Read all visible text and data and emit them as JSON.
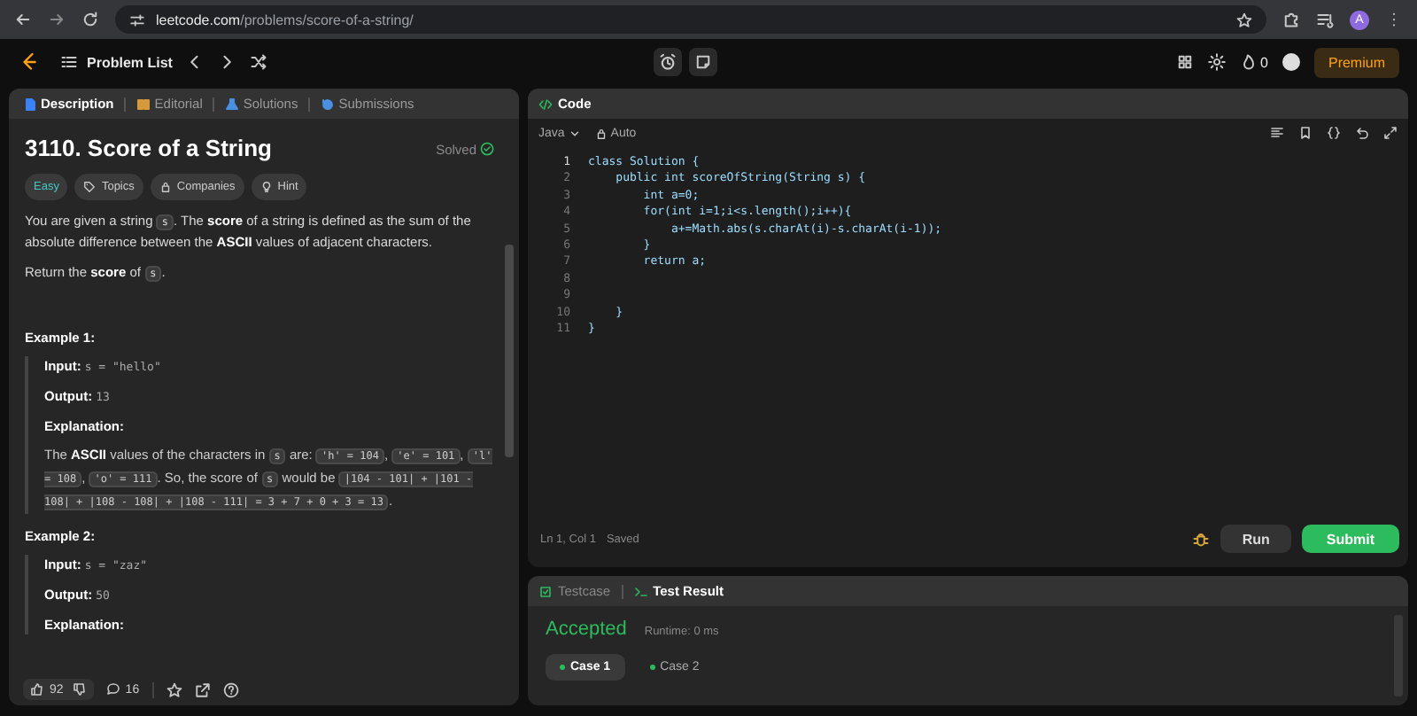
{
  "browser": {
    "url_host": "leetcode.com",
    "url_path": "/problems/score-of-a-string/",
    "profile_initial": "A"
  },
  "nav": {
    "title": "Problem List",
    "streak": "0",
    "premium": "Premium"
  },
  "description_panel": {
    "tabs": [
      {
        "label": "Description",
        "selected": true,
        "color": "#3b82f6"
      },
      {
        "label": "Editorial",
        "selected": false,
        "color": "#d69a3c"
      },
      {
        "label": "Solutions",
        "selected": false,
        "color": "#4a8fe0"
      },
      {
        "label": "Submissions",
        "selected": false,
        "color": "#4a8fe0"
      }
    ],
    "title": "3110. Score of a String",
    "status": "Solved",
    "tags": [
      {
        "kind": "difficulty",
        "label": "Easy"
      },
      {
        "kind": "topics",
        "label": "Topics"
      },
      {
        "kind": "companies",
        "label": "Companies"
      },
      {
        "kind": "hint",
        "label": "Hint"
      }
    ],
    "paragraphs": [
      [
        {
          "kind": "text",
          "text": "You are given a string "
        },
        {
          "kind": "code",
          "text": "s"
        },
        {
          "kind": "text",
          "text": ". The **score** of a string is defined as the sum of the absolute difference between the **ASCII** values of adjacent characters."
        }
      ],
      [
        {
          "kind": "text",
          "text": "Return the **score** of "
        },
        {
          "kind": "code",
          "text": "s"
        },
        {
          "kind": "text",
          "text": "."
        }
      ]
    ],
    "examples": [
      {
        "title": "Example 1:",
        "input_label": "Input:",
        "input": "s = \"hello\"",
        "output_label": "Output:",
        "output": "13",
        "explanation_label": "Explanation:",
        "explanation": [
          {
            "kind": "text",
            "text": "The **ASCII** values of the characters in "
          },
          {
            "kind": "code",
            "text": "s"
          },
          {
            "kind": "text",
            "text": " are: "
          },
          {
            "kind": "code",
            "text": "'h' = 104"
          },
          {
            "kind": "text",
            "text": ", "
          },
          {
            "kind": "code",
            "text": "'e' = 101"
          },
          {
            "kind": "text",
            "text": ", "
          },
          {
            "kind": "code",
            "text": "'l' = 108"
          },
          {
            "kind": "text",
            "text": ", "
          },
          {
            "kind": "code",
            "text": "'o' = 111"
          },
          {
            "kind": "text",
            "text": ". So, the score of "
          },
          {
            "kind": "code",
            "text": "s"
          },
          {
            "kind": "text",
            "text": " would be "
          },
          {
            "kind": "code",
            "text": "|104 - 101| + |101 - 108| + |108 - 108| + |108 - 111| = 3 + 7 + 0 + 3 = 13"
          },
          {
            "kind": "text",
            "text": "."
          }
        ]
      },
      {
        "title": "Example 2:",
        "input_label": "Input:",
        "input": "s = \"zaz\"",
        "output_label": "Output:",
        "output": "50",
        "explanation_label": "Explanation:"
      }
    ],
    "footer": {
      "likes": "92",
      "comments": "16"
    }
  },
  "code_panel": {
    "title": "Code",
    "language": "Java",
    "mode": "Auto",
    "lines": [
      {
        "number": "1",
        "text": "class Solution {"
      },
      {
        "number": "2",
        "text": "    public int scoreOfString(String s) {"
      },
      {
        "number": "3",
        "text": "        int a=0;"
      },
      {
        "number": "4",
        "text": "        for(int i=1;i<s.length();i++){"
      },
      {
        "number": "5",
        "text": "            a+=Math.abs(s.charAt(i)-s.charAt(i-1));"
      },
      {
        "number": "6",
        "text": "        }"
      },
      {
        "number": "7",
        "text": "        return a;"
      },
      {
        "number": "8"
      },
      {
        "number": "9"
      },
      {
        "number": "10",
        "text": "    }"
      },
      {
        "number": "11",
        "text": "}"
      }
    ],
    "cursor": "Ln 1, Col 1",
    "save_state": "Saved",
    "buttons": [
      {
        "label": "Run",
        "kind": "secondary"
      },
      {
        "label": "Submit",
        "kind": "primary"
      }
    ]
  },
  "result_panel": {
    "tabs": [
      {
        "label": "Testcase",
        "selected": false
      },
      {
        "label": "Test Result",
        "selected": true
      }
    ],
    "verdict": "Accepted",
    "runtime": "Runtime: 0 ms",
    "cases": [
      {
        "label": "Case 1",
        "selected": true
      },
      {
        "label": "Case 2",
        "selected": false
      }
    ]
  }
}
